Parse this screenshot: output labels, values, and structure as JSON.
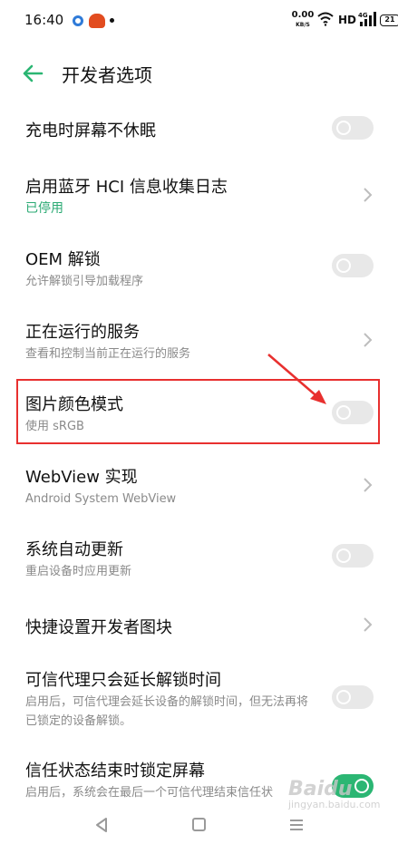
{
  "status_bar": {
    "time": "16:40",
    "net_speed_value": "0.00",
    "net_speed_unit": "KB/S",
    "hd": "HD",
    "signal_label": "4G",
    "battery": "21"
  },
  "header": {
    "title": "开发者选项",
    "back_icon": "arrow-left-icon"
  },
  "settings": [
    {
      "title": "充电时屏幕不休眠",
      "subtitle": "",
      "control": "toggle",
      "on": false
    },
    {
      "title": "启用蓝牙 HCI 信息收集日志",
      "subtitle": "已停用",
      "subtitle_style": "green",
      "control": "chevron"
    },
    {
      "title": "OEM 解锁",
      "subtitle": "允许解锁引导加载程序",
      "control": "toggle",
      "on": false
    },
    {
      "title": "正在运行的服务",
      "subtitle": "查看和控制当前正在运行的服务",
      "control": "chevron"
    },
    {
      "title": "图片颜色模式",
      "subtitle": "使用 sRGB",
      "control": "toggle",
      "on": false,
      "highlighted": true
    },
    {
      "title": "WebView 实现",
      "subtitle": "Android System WebView",
      "control": "chevron"
    },
    {
      "title": "系统自动更新",
      "subtitle": "重启设备时应用更新",
      "control": "toggle",
      "on": false
    },
    {
      "title": "快捷设置开发者图块",
      "subtitle": "",
      "control": "chevron"
    },
    {
      "title": "可信代理只会延长解锁时间",
      "subtitle": "启用后，可信代理会延长设备的解锁时间，但无法再将已锁定的设备解锁。",
      "control": "toggle",
      "on": false
    },
    {
      "title": "信任状态结束时锁定屏幕",
      "subtitle": "启用后，系统会在最后一个可信代理结束信任状",
      "control": "toggle",
      "on": true
    }
  ],
  "colors": {
    "accent": "#2bb673",
    "highlight": "#e8302f",
    "toggle_off": "#e8e8e8"
  },
  "watermark": {
    "text": "Baidu",
    "sub": "jingyan.baidu.com"
  }
}
